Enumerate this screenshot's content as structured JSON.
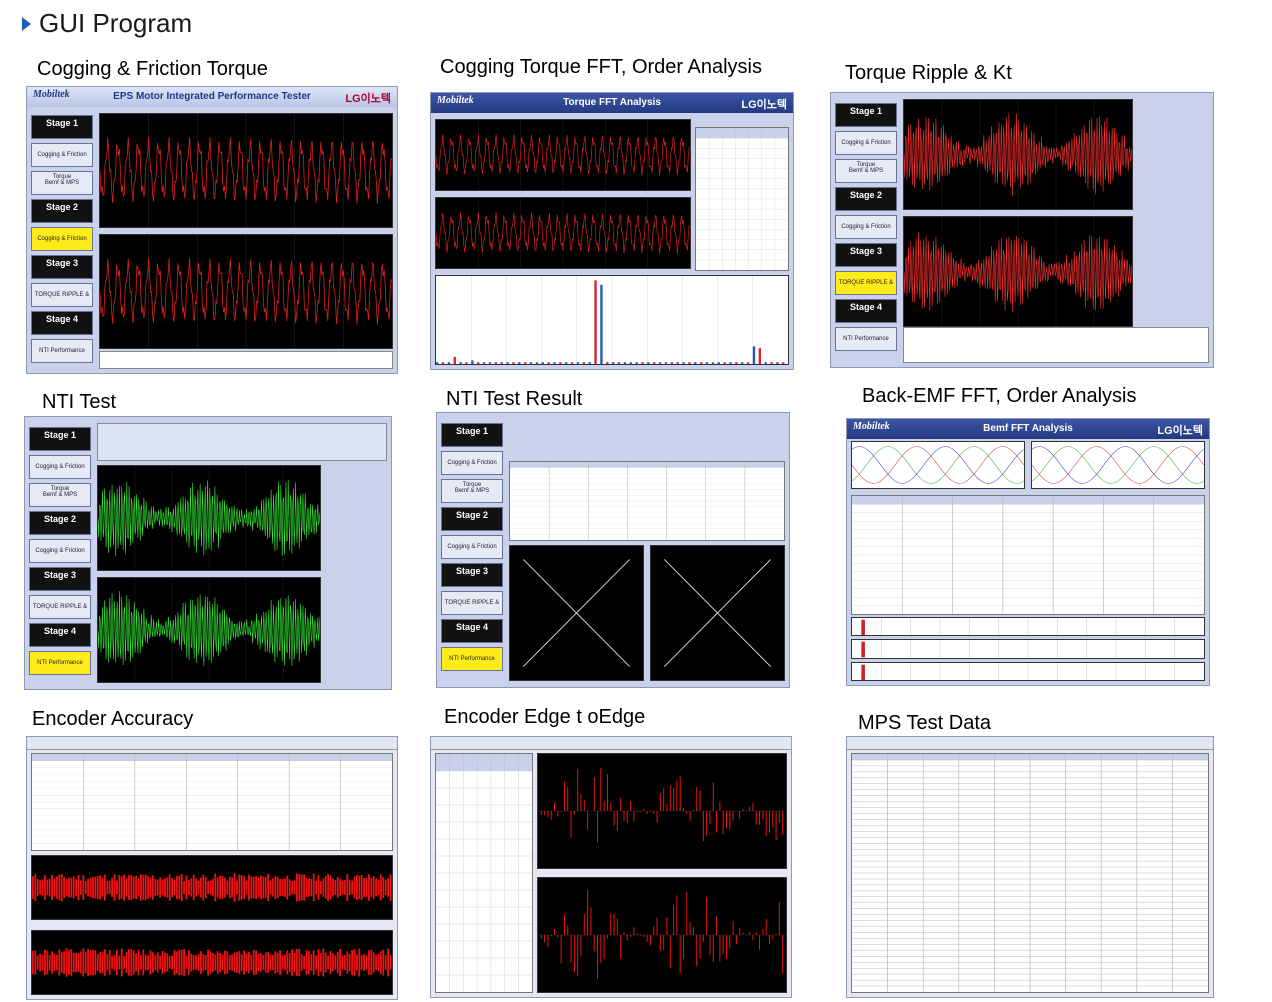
{
  "header": {
    "title": "GUI Program"
  },
  "captions": {
    "p1": "Cogging & Friction Torque",
    "p2": "Cogging  Torque FFT, Order Analysis",
    "p3": "Torque Ripple & Kt",
    "p4": "NTI Test",
    "p5": "NTI Test Result",
    "p6": "Back-EMF FFT, Order Analysis",
    "p7": "Encoder Accuracy",
    "p8": "Encoder Edge t oEdge",
    "p9": "MPS Test Data"
  },
  "app": {
    "logo": "Mobiltek",
    "title1": "EPS Motor Integrated Performance Tester",
    "title2": "Torque FFT Analysis",
    "title3": "Bemf FFT Analysis",
    "lg": "LG이노텍"
  },
  "sidebar": {
    "stage1": "Stage 1",
    "btn_cogging": "Cogging & Friction Torque",
    "btn_bemf": "Bemf & MPS",
    "stage2": "Stage 2",
    "stage3": "Stage 3",
    "btn_ripple": "TORQUE RIPPLE & Kt",
    "stage4": "Stage 4",
    "btn_nti": "NTI Performance"
  }
}
